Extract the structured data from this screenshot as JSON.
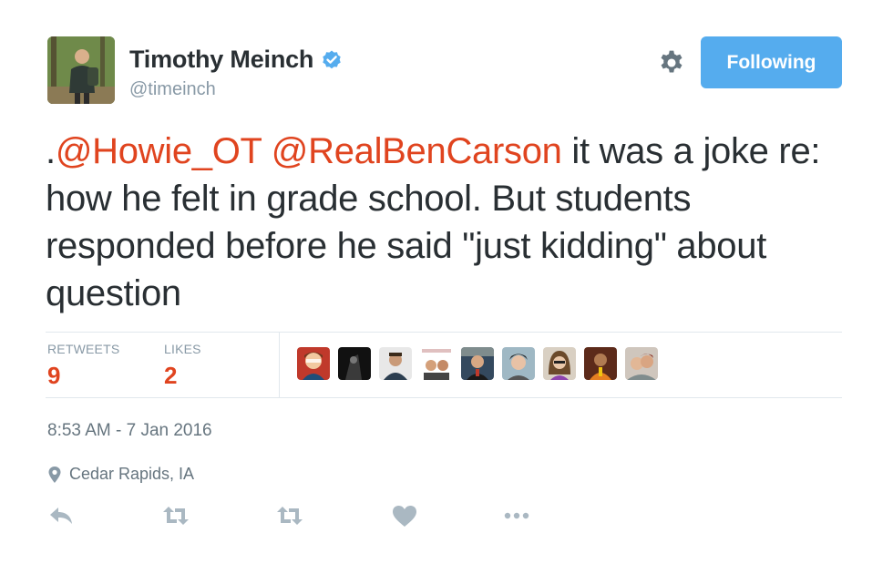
{
  "author": {
    "display_name": "Timothy Meinch",
    "handle": "@timeinch",
    "verified": true
  },
  "follow_button": {
    "label": "Following"
  },
  "tweet": {
    "lead": ".",
    "mention1": "@Howie_OT",
    "mention2": "@RealBenCarson",
    "body": "it was a joke re: how he felt in grade school. But students responded before he said \"just kidding\" about question"
  },
  "stats": {
    "retweets_label": "RETWEETS",
    "retweets_count": "9",
    "likes_label": "LIKES",
    "likes_count": "2"
  },
  "likers": [
    "liker-1",
    "liker-2",
    "liker-3",
    "liker-4",
    "liker-5",
    "liker-6",
    "liker-7",
    "liker-8",
    "liker-9"
  ],
  "timestamp": "8:53 AM - 7 Jan 2016",
  "location": "Cedar Rapids, IA",
  "actions": [
    "reply-icon",
    "retweet-icon",
    "retweet-icon",
    "heart-icon",
    "more-icon"
  ],
  "colors": {
    "mention": "#e0441f",
    "follow_button": "#55acee",
    "count": "#e0441f",
    "muted": "#8899a6",
    "icon": "#aab8c2"
  }
}
